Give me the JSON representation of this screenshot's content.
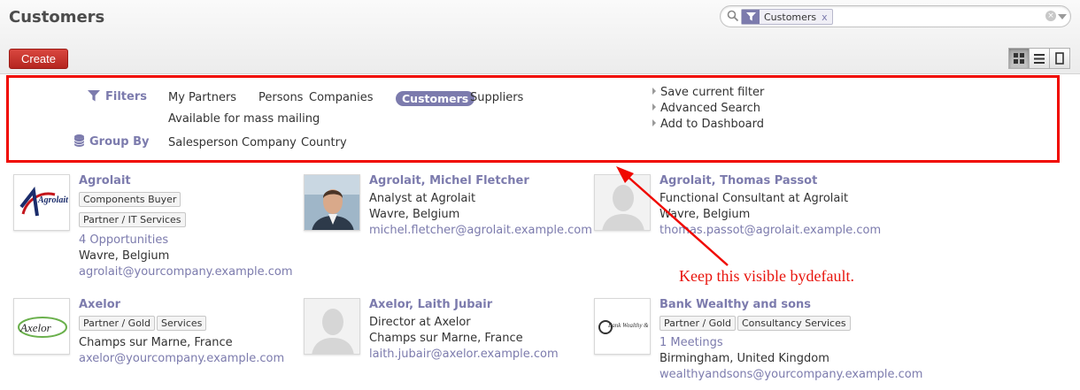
{
  "header": {
    "title": "Customers",
    "create_label": "Create"
  },
  "search": {
    "facet_label": "Customers",
    "facet_remove": "x",
    "clear": "×"
  },
  "view_switcher": [
    {
      "name": "kanban-view",
      "icon": "grid-icon",
      "active": true
    },
    {
      "name": "list-view",
      "icon": "list-icon",
      "active": false
    },
    {
      "name": "form-view",
      "icon": "form-icon",
      "active": false
    }
  ],
  "drawer": {
    "filters_label": "Filters",
    "groupby_label": "Group By",
    "filters": [
      "My Partners",
      "Persons",
      "Companies",
      "Customers",
      "Suppliers",
      "Available for mass mailing"
    ],
    "selected_filter": "Customers",
    "groupby": [
      "Salesperson",
      "Company",
      "Country"
    ],
    "actions": [
      "Save current filter",
      "Advanced Search",
      "Add to Dashboard"
    ]
  },
  "cards": [
    {
      "name": "Agrolait",
      "tags": [
        "Components Buyer",
        "Partner / IT Services"
      ],
      "opportunities": "4 Opportunities",
      "location": "Wavre, Belgium",
      "email": "agrolait@yourcompany.example.com",
      "logo_text": "Agrolait"
    },
    {
      "name": "Agrolait, Michel Fletcher",
      "job": "Analyst at Agrolait",
      "location": "Wavre, Belgium",
      "email": "michel.fletcher@agrolait.example.com"
    },
    {
      "name": "Agrolait, Thomas Passot",
      "job": "Functional Consultant at Agrolait",
      "location": "Wavre, Belgium",
      "email": "thomas.passot@agrolait.example.com"
    },
    {
      "name": "Axelor",
      "tags": [
        "Partner / Gold",
        "Services"
      ],
      "location": "Champs sur Marne, France",
      "email": "axelor@yourcompany.example.com",
      "logo_text": "Axelor"
    },
    {
      "name": "Axelor, Laith Jubair",
      "job": "Director at Axelor",
      "location": "Champs sur Marne, France",
      "email": "laith.jubair@axelor.example.com"
    },
    {
      "name": "Bank Wealthy and sons",
      "tags": [
        "Partner / Gold",
        "Consultancy Services"
      ],
      "meetings": "1 Meetings",
      "location": "Birmingham, United Kingdom",
      "email": "wealthyandsons@yourcompany.example.com",
      "logo_text": "Bank Wealthy & Sons"
    }
  ],
  "annotation": {
    "text": "Keep this visible bydefault.",
    "color": "#e8140c"
  },
  "colors": {
    "accent": "#7c7bad",
    "create_button": "#c8312b",
    "highlight_box": "#f00800"
  }
}
